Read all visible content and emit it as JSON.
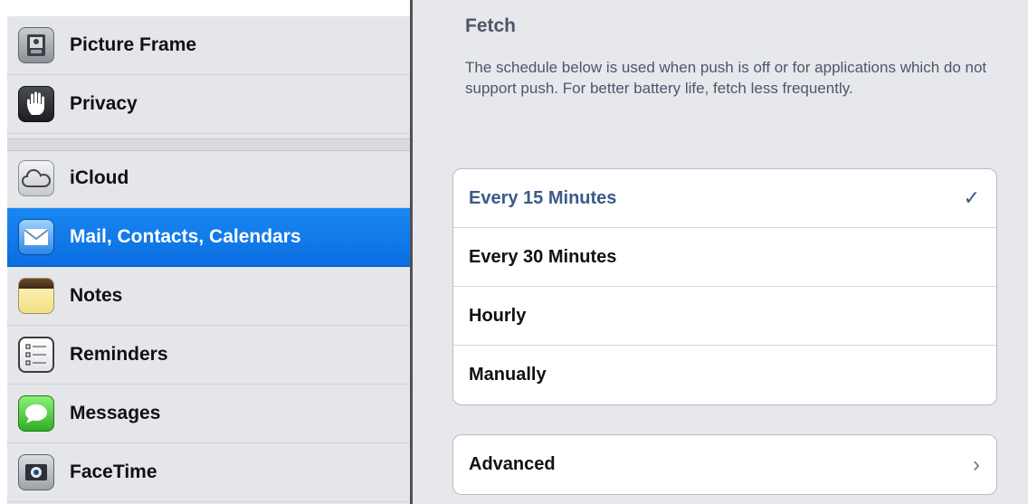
{
  "sidebar": {
    "items": [
      {
        "label": "Picture Frame",
        "icon": "picture-frame-icon",
        "selected": false
      },
      {
        "label": "Privacy",
        "icon": "privacy-hand-icon",
        "selected": false
      },
      {
        "label": "iCloud",
        "icon": "icloud-icon",
        "selected": false
      },
      {
        "label": "Mail, Contacts, Calendars",
        "icon": "mail-icon",
        "selected": true
      },
      {
        "label": "Notes",
        "icon": "notes-icon",
        "selected": false
      },
      {
        "label": "Reminders",
        "icon": "reminders-icon",
        "selected": false
      },
      {
        "label": "Messages",
        "icon": "messages-icon",
        "selected": false
      },
      {
        "label": "FaceTime",
        "icon": "facetime-icon",
        "selected": false
      }
    ]
  },
  "main": {
    "section_title": "Fetch",
    "description": "The schedule below is used when push is off or for applications which do not support push. For better battery life, fetch less frequently.",
    "options": [
      {
        "label": "Every 15 Minutes",
        "checked": true
      },
      {
        "label": "Every 30 Minutes",
        "checked": false
      },
      {
        "label": "Hourly",
        "checked": false
      },
      {
        "label": "Manually",
        "checked": false
      }
    ],
    "check_glyph": "✓",
    "advanced_label": "Advanced",
    "chevron_glyph": "›"
  },
  "colors": {
    "selected_row": "#0a6ee0",
    "checked_text": "#3b5a88",
    "background": "#e6e8ec"
  }
}
